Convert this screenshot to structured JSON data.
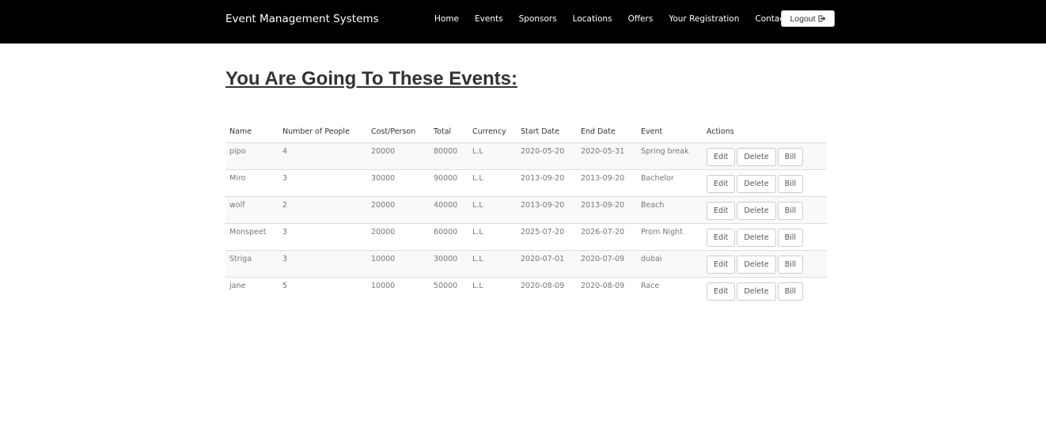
{
  "navbar": {
    "brand": "Event Management Systems",
    "links": [
      "Home",
      "Events",
      "Sponsors",
      "Locations",
      "Offers",
      "Your Registration",
      "Contact Us"
    ],
    "logout_label": "Logout",
    "logout_icon": "sign-out-icon"
  },
  "page": {
    "title": "You Are Going To These Events:"
  },
  "table": {
    "headers": [
      "Name",
      "Number of People",
      "Cost/Person",
      "Total",
      "Currency",
      "Start Date",
      "End Date",
      "Event",
      "Actions"
    ],
    "rows": [
      {
        "name": "pipo",
        "people": "4",
        "cost": "20000",
        "total": "80000",
        "currency": "L.L",
        "start": "2020-05-20",
        "end": "2020-05-31",
        "event": "Spring break"
      },
      {
        "name": "Miro",
        "people": "3",
        "cost": "30000",
        "total": "90000",
        "currency": "L.L",
        "start": "2013-09-20",
        "end": "2013-09-20",
        "event": "Bachelor"
      },
      {
        "name": "wolf",
        "people": "2",
        "cost": "20000",
        "total": "40000",
        "currency": "L.L",
        "start": "2013-09-20",
        "end": "2013-09-20",
        "event": "Beach"
      },
      {
        "name": "Monspeet",
        "people": "3",
        "cost": "20000",
        "total": "60000",
        "currency": "L.L",
        "start": "2025-07-20",
        "end": "2026-07-20",
        "event": "Prom Night"
      },
      {
        "name": "Striga",
        "people": "3",
        "cost": "10000",
        "total": "30000",
        "currency": "L.L",
        "start": "2020-07-01",
        "end": "2020-07-09",
        "event": "dubai"
      },
      {
        "name": "jane",
        "people": "5",
        "cost": "10000",
        "total": "50000",
        "currency": "L.L",
        "start": "2020-08-09",
        "end": "2020-08-09",
        "event": "Race"
      }
    ],
    "actions": {
      "edit": "Edit",
      "delete": "Delete",
      "bill": "Bill"
    }
  }
}
